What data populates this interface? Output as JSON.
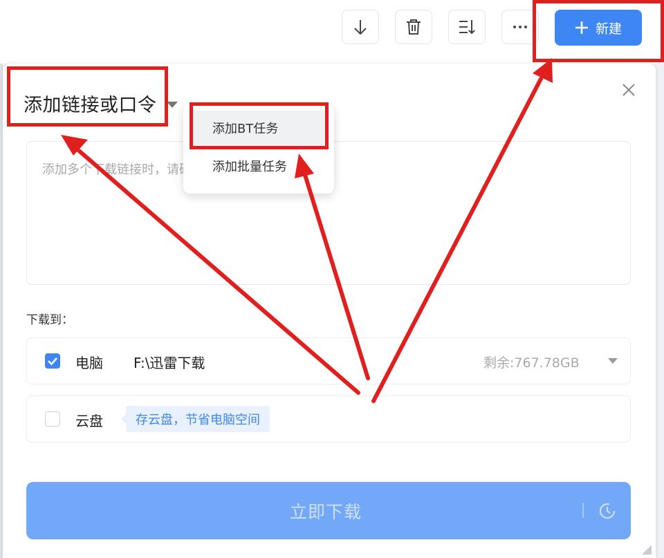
{
  "toolbar": {
    "new_label": "新建"
  },
  "dialog": {
    "title": "添加链接或口令",
    "link_placeholder": "添加多个下载链接时，请确保每行只有一个链接。",
    "menu": [
      {
        "label": "添加BT任务"
      },
      {
        "label": "添加批量任务"
      }
    ],
    "save_to_label": "下载到：",
    "options": [
      {
        "name": "电脑",
        "path": "F:\\迅雷下载",
        "free_space": "剩余:767.78GB",
        "checked": true
      },
      {
        "name": "云盘",
        "tag": "存云盘，节省电脑空间",
        "checked": false
      }
    ],
    "download_label": "立即下载"
  },
  "colors": {
    "accent": "#3f86f5",
    "download_disabled": "#73a7f7",
    "annotation": "#e0201f"
  }
}
